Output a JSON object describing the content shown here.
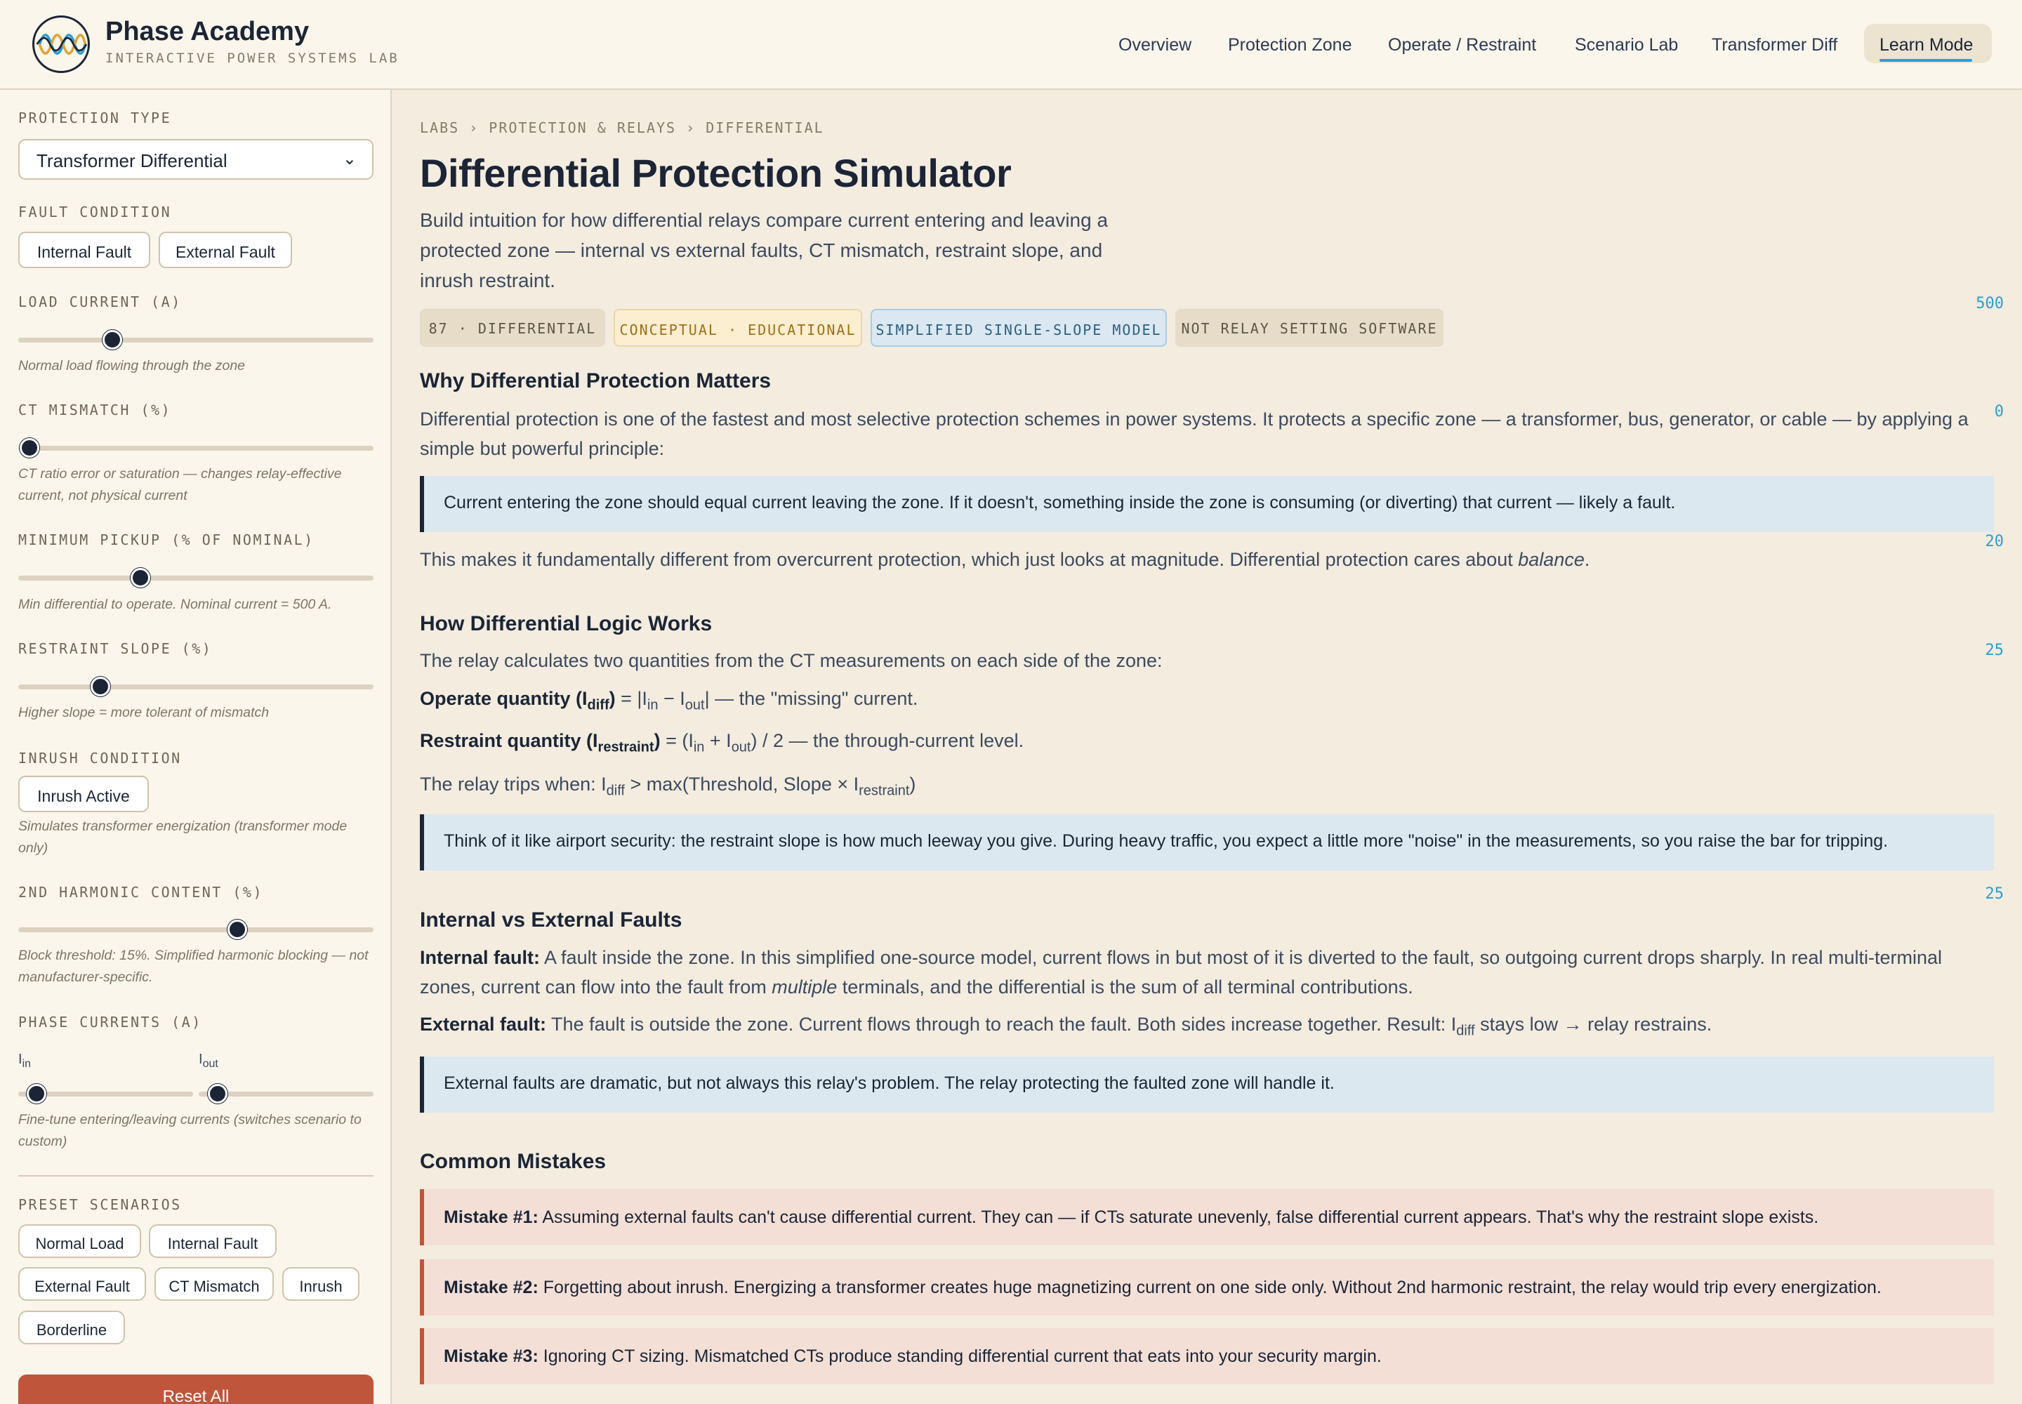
{
  "header": {
    "brand_title": "Phase Academy",
    "brand_subtitle": "INTERACTIVE POWER SYSTEMS LAB",
    "nav": [
      "Overview",
      "Protection Zone",
      "Operate / Restraint",
      "Scenario Lab",
      "Transformer Diff"
    ],
    "nav_active": "Learn Mode"
  },
  "sidebar": {
    "protection_type_label": "PROTECTION TYPE",
    "protection_type_value": "Transformer Differential",
    "fault_condition_label": "FAULT CONDITION",
    "fault_buttons": [
      "Internal Fault",
      "External Fault"
    ],
    "load_current_label": "LOAD CURRENT (A)",
    "load_current_value": "500",
    "load_current_level": 0.27,
    "load_current_hint": "Normal load flowing through the zone",
    "ct_mismatch_label": "CT MISMATCH (%)",
    "ct_mismatch_value": "0",
    "ct_mismatch_hint": "CT ratio error or saturation — changes relay-effective current, not physical current",
    "min_pickup_label": "MINIMUM PICKUP (% OF NOMINAL)",
    "min_pickup_value": "20",
    "min_pickup_hint": "Min differential to operate. Nominal current = 500 A.",
    "slope_label": "RESTRAINT SLOPE (%)",
    "slope_value": "25",
    "slope_hint": "Higher slope = more tolerant of mismatch",
    "inrush_label": "INRUSH CONDITION",
    "inrush_button": "Inrush Active",
    "inrush_hint": "Simulates transformer energization (transformer mode only)",
    "harmonic_label": "2ND HARMONIC CONTENT (%)",
    "harmonic_value": "25",
    "harmonic_hint": "Block threshold: 15%. Simplified harmonic blocking — not manufacturer-specific.",
    "phase_currents_label": "PHASE CURRENTS (A)",
    "i_in_label": "I",
    "i_in_sub": "in",
    "i_out_label": "I",
    "i_out_sub": "out",
    "phase_hint": "Fine-tune entering/leaving currents (switches scenario to custom)",
    "presets_label": "PRESET SCENARIOS",
    "presets": [
      "Normal Load",
      "Internal Fault",
      "External Fault",
      "CT Mismatch",
      "Inrush",
      "Borderline"
    ],
    "reset_label": "Reset All"
  },
  "main": {
    "breadcrumb": "LABS › PROTECTION & RELAYS › DIFFERENTIAL",
    "title": "Differential Protection Simulator",
    "intro": "Build intuition for how differential relays compare current entering and leaving a protected zone — internal vs external faults, CT mismatch, restraint slope, and inrush restraint.",
    "badges": [
      "87 · DIFFERENTIAL",
      "CONCEPTUAL · EDUCATIONAL",
      "SIMPLIFIED SINGLE-SLOPE MODEL",
      "NOT RELAY SETTING SOFTWARE"
    ],
    "s1_title": "Why Differential Protection Matters",
    "s1_p1": "Differential protection is one of the fastest and most selective protection schemes in power systems. It protects a specific zone — a transformer, bus, generator, or cable — by applying a simple but powerful principle:",
    "s1_callout": "Current entering the zone should equal current leaving the zone. If it doesn't, something inside the zone is consuming (or diverting) that current — likely a fault.",
    "s1_p2_a": "This makes it fundamentally different from overcurrent protection, which just looks at magnitude. Differential protection cares about ",
    "s1_p2_em": "balance",
    "s1_p2_b": ".",
    "s2_title": "How Differential Logic Works",
    "s2_p1": "The relay calculates two quantities from the CT measurements on each side of the zone:",
    "s2_operate_bold": "Operate quantity (I",
    "s2_operate_sub": "diff",
    "s2_operate_bold_end": ")",
    "s2_operate_rest_a": " = |I",
    "s2_operate_in": "in",
    "s2_operate_mid": " − I",
    "s2_operate_out": "out",
    "s2_operate_rest_b": "| — the \"missing\" current.",
    "s2_restraint_bold": "Restraint quantity (I",
    "s2_restraint_sub": "restraint",
    "s2_restraint_bold_end": ")",
    "s2_restraint_rest_a": " = (I",
    "s2_restraint_in": "in",
    "s2_restraint_mid": " + I",
    "s2_restraint_out": "out",
    "s2_restraint_rest_b": ") / 2 — the through-current level.",
    "s2_trip_a": "The relay trips when: I",
    "s2_trip_sub1": "diff",
    "s2_trip_b": " > max(Threshold, Slope × I",
    "s2_trip_sub2": "restraint",
    "s2_trip_c": ")",
    "s2_callout": "Think of it like airport security: the restraint slope is how much leeway you give. During heavy traffic, you expect a little more \"noise\" in the measurements, so you raise the bar for tripping.",
    "s3_title": "Internal vs External Faults",
    "s3_internal_bold": "Internal fault:",
    "s3_internal_a": " A fault inside the zone. In this simplified one-source model, current flows in but most of it is diverted to the fault, so outgoing current drops sharply. In real multi-terminal zones, current can flow into the fault from ",
    "s3_internal_em": "multiple",
    "s3_internal_b": " terminals, and the differential is the sum of all terminal contributions.",
    "s3_external_bold": "External fault:",
    "s3_external_a": " The fault is outside the zone. Current flows through to reach the fault. Both sides increase together. Result: I",
    "s3_external_sub": "diff",
    "s3_external_b": " stays low → relay restrains.",
    "s3_callout": "External faults are dramatic, but not always this relay's problem. The relay protecting the faulted zone will handle it.",
    "s4_title": "Common Mistakes",
    "mistakes": [
      {
        "bold": "Mistake #1:",
        "text": " Assuming external faults can't cause differential current. They can — if CTs saturate unevenly, false differential current appears. That's why the restraint slope exists."
      },
      {
        "bold": "Mistake #2:",
        "text": " Forgetting about inrush. Energizing a transformer creates huge magnetizing current on one side only. Without 2nd harmonic restraint, the relay would trip every energization."
      },
      {
        "bold": "Mistake #3:",
        "text": " Ignoring CT sizing. Mismatched CTs produce standing differential current that eats into your security margin."
      }
    ]
  }
}
